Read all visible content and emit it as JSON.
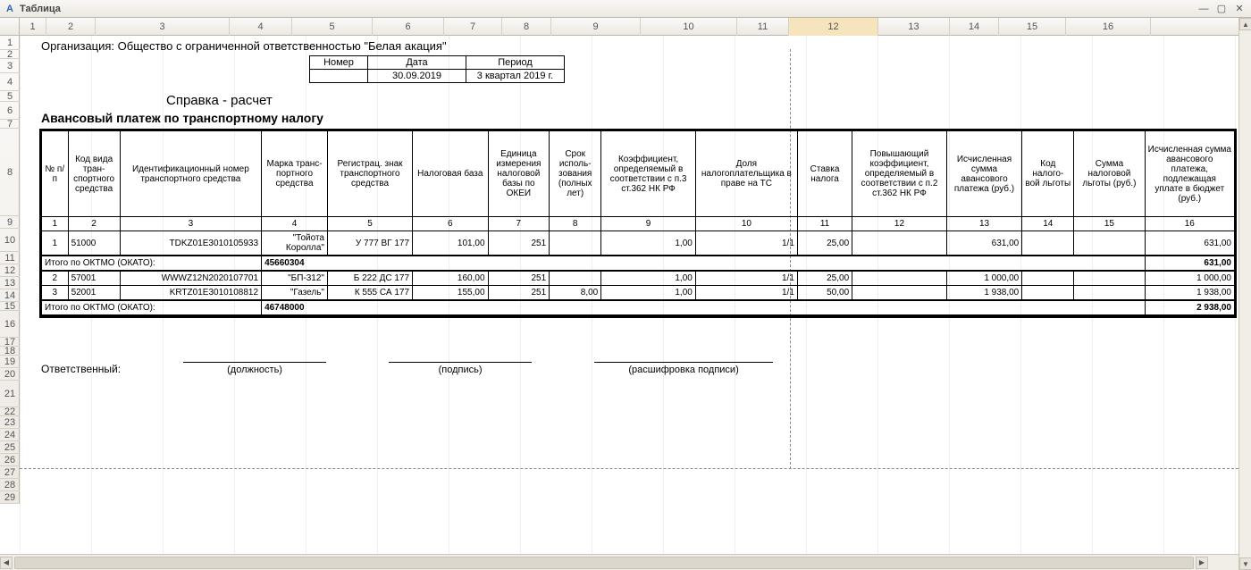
{
  "window": {
    "title": "Таблица"
  },
  "column_ruler": [
    "1",
    "2",
    "3",
    "4",
    "5",
    "6",
    "7",
    "8",
    "9",
    "10",
    "11",
    "12",
    "13",
    "14",
    "15",
    "16"
  ],
  "active_column": "12",
  "row_numbers": [
    "1",
    "2",
    "3",
    "4",
    "5",
    "6",
    "7",
    "8",
    "9",
    "10",
    "11",
    "12",
    "13",
    "14",
    "15",
    "16",
    "17",
    "18",
    "19",
    "20",
    "21",
    "22",
    "23",
    "24",
    "25",
    "26",
    "27",
    "28",
    "29"
  ],
  "report": {
    "org_line": "Организация: Общество с ограниченной ответственностью \"Белая акация\"",
    "ref_label": "Справка - расчет",
    "header_cells": {
      "number_label": "Номер",
      "date_label": "Дата",
      "period_label": "Период",
      "number_value": "",
      "date_value": "30.09.2019",
      "period_value": "3 квартал 2019 г."
    },
    "subtitle": "Авансовый платеж по транспортному налогу",
    "columns": [
      "№ п/п",
      "Код вида тран-спортного средства",
      "Идентификационный номер транспортного средства",
      "Марка транс-портного средства",
      "Регистрац. знак транспортного средства",
      "Налоговая база",
      "Единица измерения налоговой базы по ОКЕИ",
      "Срок исполь-зования (полных лет)",
      "Коэффициент, определяемый в соответствии с п.3 ст.362 НК РФ",
      "Доля налогоплательщика в праве на ТС",
      "Ставка налога",
      "Повышающий коэффициент, определяемый в соответствии с п.2 ст.362 НК РФ",
      "Исчисленная сумма авансового платежа (руб.)",
      "Код налого-вой льготы",
      "Сумма налоговой льготы (руб.)",
      "Исчисленная сумма авансового платежа, подлежащая уплате в бюджет (руб.)"
    ],
    "col_numbers": [
      "1",
      "2",
      "3",
      "4",
      "5",
      "6",
      "7",
      "8",
      "9",
      "10",
      "11",
      "12",
      "13",
      "14",
      "15",
      "16"
    ],
    "rows": [
      {
        "n": "1",
        "code": "51000",
        "vin": "TDKZ01E3010105933",
        "brand": "\"Тойота Королла\"",
        "plate": "У 777 ВГ 177",
        "base": "101,00",
        "okei": "251",
        "years": "",
        "coef3": "1,00",
        "share": "1/1",
        "rate": "25,00",
        "coef2": "",
        "sum": "631,00",
        "benefit_code": "",
        "benefit_sum": "",
        "due": "631,00"
      }
    ],
    "subtotal1": {
      "label": "Итого по ОКТМО (ОКАТО):",
      "oktmo": "45660304",
      "due": "631,00"
    },
    "rows2": [
      {
        "n": "2",
        "code": "57001",
        "vin": "WWWZ12N2020107701",
        "brand": "\"БП-312\"",
        "plate": "Б 222 ДС 177",
        "base": "160,00",
        "okei": "251",
        "years": "",
        "coef3": "1,00",
        "share": "1/1",
        "rate": "25,00",
        "coef2": "",
        "sum": "1 000,00",
        "benefit_code": "",
        "benefit_sum": "",
        "due": "1 000,00"
      },
      {
        "n": "3",
        "code": "52001",
        "vin": "KRTZ01E3010108812",
        "brand": "\"Газель\"",
        "plate": "К 555 СА 177",
        "base": "155,00",
        "okei": "251",
        "years": "8,00",
        "coef3": "1,00",
        "share": "1/1",
        "rate": "50,00",
        "coef2": "",
        "sum": "1 938,00",
        "benefit_code": "",
        "benefit_sum": "",
        "due": "1 938,00"
      }
    ],
    "subtotal2": {
      "label": "Итого по ОКТМО (ОКАТО):",
      "oktmo": "46748000",
      "due": "2 938,00"
    },
    "sign": {
      "responsible": "Ответственный:",
      "position": "(должность)",
      "signature": "(подпись)",
      "full_name": "(расшифровка подписи)"
    }
  }
}
